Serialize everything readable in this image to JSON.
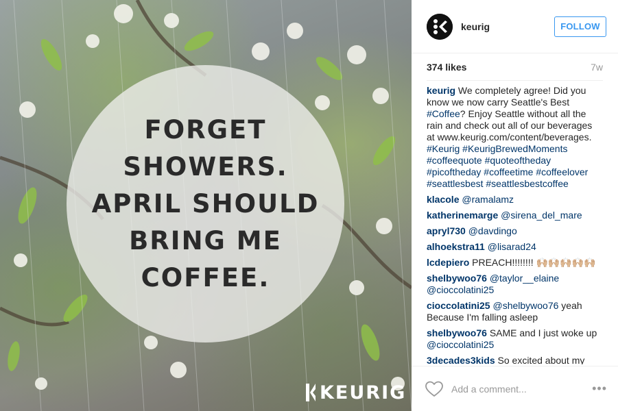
{
  "post": {
    "image": {
      "quote_lines": [
        "FORGET",
        "SHOWERS.",
        "APRIL SHOULD",
        "BRING ME",
        "COFFEE."
      ],
      "brand_watermark": "KEURIG"
    }
  },
  "header": {
    "username": "keurig",
    "follow_label": "FOLLOW",
    "avatar_icon": "keurig-logo-icon"
  },
  "meta": {
    "likes": "374 likes",
    "age": "7w"
  },
  "caption": {
    "user": "keurig",
    "text_1": " We completely agree! Did you know we now carry Seattle's Best ",
    "tag_coffee": "#Coffee",
    "text_2": "? Enjoy Seattle without all the rain and check out all of our beverages at www.keurig.com/content/beverages. ",
    "tags": [
      "#Keurig",
      "#KeurigBrewedMoments",
      "#coffeequote",
      "#quoteoftheday",
      "#picoftheday",
      "#coffeetime",
      "#coffeelover",
      "#seattlesbest",
      "#seattlesbestcoffee"
    ]
  },
  "comments": [
    {
      "user": "klacole",
      "mention": "@ramalamz",
      "text": ""
    },
    {
      "user": "katherinemarge",
      "mention": "@sirena_del_mare",
      "text": ""
    },
    {
      "user": "apryl730",
      "mention": "@davdingo",
      "text": ""
    },
    {
      "user": "alhoekstra11",
      "mention": "@lisarad24",
      "text": ""
    },
    {
      "user": "lcdepiero",
      "mention": "",
      "text": "PREACH!!!!!!!! 🙌🏼🙌🏼🙌🏼🙌🏼🙌🏼"
    },
    {
      "user": "shelbywoo76",
      "mention": "@taylor__elaine @cioccolatini25",
      "text": ""
    },
    {
      "user": "cioccolatini25",
      "mention": "@shelbywoo76",
      "text": " yeah Because I'm falling asleep"
    },
    {
      "user": "shelbywoo76",
      "mention": "",
      "text": "SAME and I just woke up",
      "mention_after": "@cioccolatini25"
    },
    {
      "user": "3decades3kids",
      "mention": "",
      "text": "So excited about my new"
    }
  ],
  "footer": {
    "add_comment_placeholder": "Add a comment...",
    "more_label": "•••",
    "like_icon": "heart-icon"
  }
}
